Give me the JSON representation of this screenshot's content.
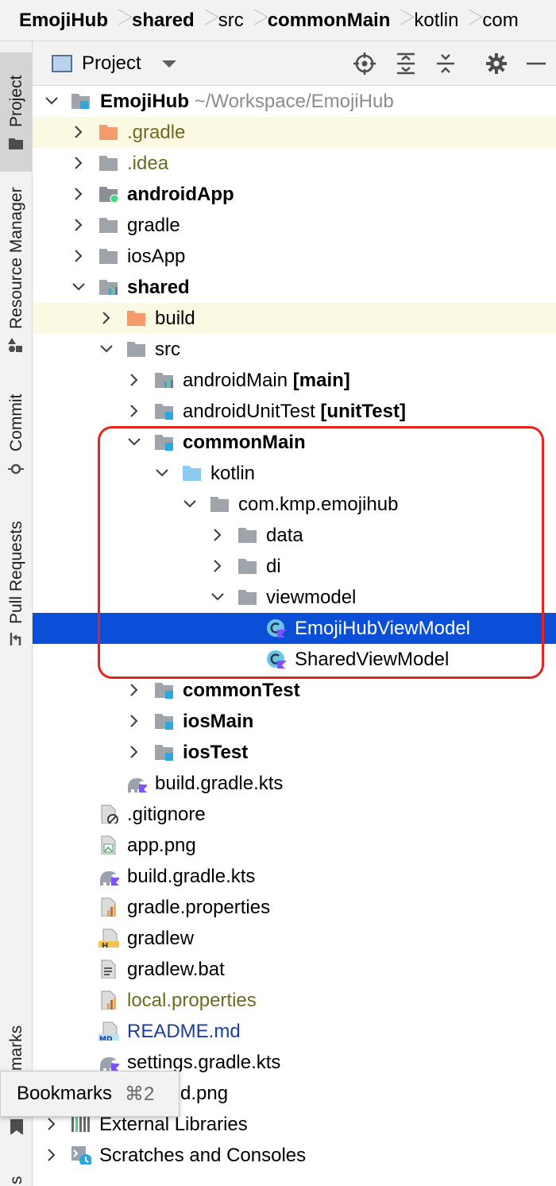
{
  "breadcrumb": {
    "items": [
      {
        "label": "EmojiHub",
        "bold": true
      },
      {
        "label": "shared",
        "bold": true
      },
      {
        "label": "src",
        "bold": false
      },
      {
        "label": "commonMain",
        "bold": true
      },
      {
        "label": "kotlin",
        "bold": false
      },
      {
        "label": "com",
        "bold": false
      }
    ]
  },
  "tool_strip": {
    "project": "Project",
    "resource_manager": "Resource Manager",
    "commit": "Commit",
    "pull_requests": "Pull Requests",
    "bookmarks_partial": "marks",
    "bottom_partial": "s"
  },
  "header": {
    "view_label": "Project",
    "icons": [
      "locate-icon",
      "expand-all-icon",
      "collapse-all-icon",
      "gear-icon",
      "minimize-icon"
    ]
  },
  "tree": {
    "rows": [
      {
        "label": "EmojiHub",
        "suffix": " ~/Workspace/EmojiHub",
        "icon": "module-folder"
      },
      {
        "label": ".gradle",
        "icon": "orange-folder"
      },
      {
        "label": ".idea",
        "icon": "grey-folder"
      },
      {
        "label": "androidApp",
        "icon": "android-module-folder"
      },
      {
        "label": "gradle",
        "icon": "grey-folder"
      },
      {
        "label": "iosApp",
        "icon": "grey-folder"
      },
      {
        "label": "shared",
        "icon": "shared-module-folder"
      },
      {
        "label": "build",
        "icon": "orange-folder"
      },
      {
        "label": "src",
        "icon": "grey-folder"
      },
      {
        "label": "androidMain",
        "suffix": " [main]",
        "icon": "source-set-folder"
      },
      {
        "label": "androidUnitTest",
        "suffix": " [unitTest]",
        "icon": "module-folder"
      },
      {
        "label": "commonMain",
        "icon": "module-folder"
      },
      {
        "label": "kotlin",
        "icon": "source-root-folder"
      },
      {
        "label": "com.kmp.emojihub",
        "icon": "package-folder"
      },
      {
        "label": "data",
        "icon": "package-folder"
      },
      {
        "label": "di",
        "icon": "package-folder"
      },
      {
        "label": "viewmodel",
        "icon": "package-folder"
      },
      {
        "label": "EmojiHubViewModel",
        "icon": "kotlin-class"
      },
      {
        "label": "SharedViewModel",
        "icon": "kotlin-class"
      },
      {
        "label": "commonTest",
        "icon": "module-folder"
      },
      {
        "label": "iosMain",
        "icon": "module-folder"
      },
      {
        "label": "iosTest",
        "icon": "module-folder"
      },
      {
        "label": "build.gradle.kts",
        "icon": "gradle-kts-file"
      },
      {
        "label": ".gitignore",
        "icon": "ignore-file"
      },
      {
        "label": "app.png",
        "icon": "image-file"
      },
      {
        "label": "build.gradle.kts",
        "icon": "gradle-kts-file"
      },
      {
        "label": "gradle.properties",
        "icon": "properties-file"
      },
      {
        "label": "gradlew",
        "icon": "shell-file"
      },
      {
        "label": "gradlew.bat",
        "icon": "text-file"
      },
      {
        "label": "local.properties",
        "icon": "properties-file"
      },
      {
        "label": "README.md",
        "icon": "markdown-file"
      },
      {
        "label": "settings.gradle.kts",
        "icon": "gradle-kts-file"
      },
      {
        "label": "d.png",
        "icon": "image-file"
      },
      {
        "label": "External Libraries",
        "icon": "libraries-icon"
      },
      {
        "label": "Scratches and Consoles",
        "icon": "scratches-icon"
      }
    ]
  },
  "bookmarks_tooltip": {
    "label": "Bookmarks",
    "shortcut": "⌘2"
  },
  "colors": {
    "selection": "#0b4ed8",
    "highlight_box": "#e8231d",
    "excluded_bg": "#fcf9e3",
    "orange_folder": "#f59a6a",
    "source_root": "#8ccaf0"
  }
}
